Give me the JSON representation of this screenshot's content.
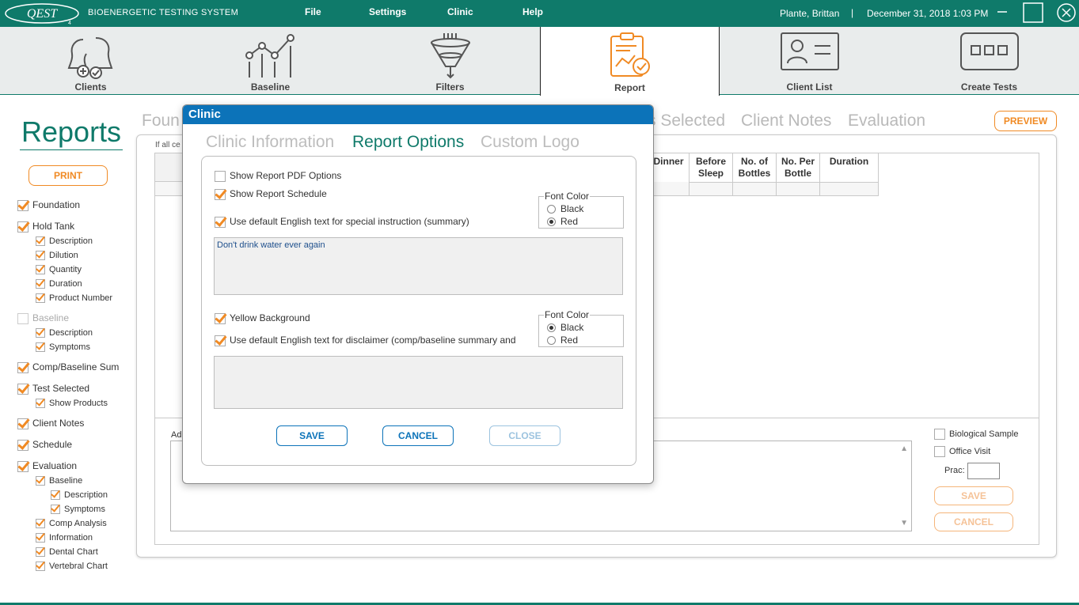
{
  "app": {
    "logo_text": "QEST",
    "logo_sub": "4",
    "title": "BIOENERGETIC TESTING SYSTEM",
    "user": "Plante, Brittan",
    "separator": "|",
    "datetime": "December 31, 2018  1:03 PM"
  },
  "menu": {
    "file": "File",
    "settings": "Settings",
    "clinic": "Clinic",
    "help": "Help"
  },
  "toolbar": [
    {
      "label": "Clients",
      "icon": "clients-icon"
    },
    {
      "label": "Baseline",
      "icon": "baseline-icon"
    },
    {
      "label": "Filters",
      "icon": "filters-icon"
    },
    {
      "label": "Report",
      "icon": "report-icon"
    },
    {
      "label": "Client List",
      "icon": "client-list-icon"
    },
    {
      "label": "Create Tests",
      "icon": "create-tests-icon"
    }
  ],
  "page": {
    "title": "Reports",
    "print": "PRINT",
    "preview": "PREVIEW",
    "bg_tabs": [
      "Foun",
      "s Selected",
      "Client Notes",
      "Evaluation"
    ],
    "hint": "If all ce",
    "notes_label": "Ad"
  },
  "sections": [
    {
      "label": "Foundation",
      "checked": true,
      "level": 0
    },
    {
      "label": "Hold Tank",
      "checked": true,
      "level": 0
    },
    {
      "label": "Description",
      "checked": true,
      "level": 1
    },
    {
      "label": "Dilution",
      "checked": true,
      "level": 1
    },
    {
      "label": "Quantity",
      "checked": true,
      "level": 1
    },
    {
      "label": "Duration",
      "checked": true,
      "level": 1
    },
    {
      "label": "Product Number",
      "checked": true,
      "level": 1
    },
    {
      "label": "Baseline",
      "checked": false,
      "level": 0,
      "disabled": true
    },
    {
      "label": "Description",
      "checked": true,
      "level": 1
    },
    {
      "label": "Symptoms",
      "checked": true,
      "level": 1
    },
    {
      "label": "Comp/Baseline Sum",
      "checked": true,
      "level": 0
    },
    {
      "label": "Test Selected",
      "checked": true,
      "level": 0
    },
    {
      "label": "Show Products",
      "checked": true,
      "level": 1
    },
    {
      "label": "Client Notes",
      "checked": true,
      "level": 0
    },
    {
      "label": "Schedule",
      "checked": true,
      "level": 0
    },
    {
      "label": "Evaluation",
      "checked": true,
      "level": 0
    },
    {
      "label": "Baseline",
      "checked": true,
      "level": 1
    },
    {
      "label": "Description",
      "checked": true,
      "level": 2
    },
    {
      "label": "Symptoms",
      "checked": true,
      "level": 2
    },
    {
      "label": "Comp Analysis",
      "checked": true,
      "level": 1
    },
    {
      "label": "Information",
      "checked": true,
      "level": 1
    },
    {
      "label": "Dental Chart",
      "checked": true,
      "level": 1
    },
    {
      "label": "Vertebral Chart",
      "checked": true,
      "level": 1
    }
  ],
  "table": {
    "headers": [
      "Dinner",
      "Before Sleep",
      "No. of Bottles",
      "No. Per Bottle",
      "Duration"
    ]
  },
  "right_panel": {
    "bio_sample": "Biological Sample",
    "office_visit": "Office Visit",
    "prac": "Prac:",
    "save": "SAVE",
    "cancel": "CANCEL"
  },
  "dialog": {
    "title": "Clinic",
    "tabs": [
      "Clinic Information",
      "Report Options",
      "Custom Logo"
    ],
    "active_tab": "Report Options",
    "show_pdf_options": {
      "label": "Show Report PDF Options",
      "checked": false
    },
    "show_schedule": {
      "label": "Show Report Schedule",
      "checked": true
    },
    "default_summary": {
      "label": "Use default English text for special instruction (summary)",
      "checked": true
    },
    "font_color_1": {
      "legend": "Font Color",
      "options": [
        "Black",
        "Red"
      ],
      "selected": "Red"
    },
    "summary_text": "Don't drink water ever again",
    "yellow_bg": {
      "label": "Yellow Background",
      "checked": true
    },
    "default_disclaimer": {
      "label": "Use default English text for disclaimer (comp/baseline summary and",
      "checked": true
    },
    "font_color_2": {
      "legend": "Font Color",
      "options": [
        "Black",
        "Red"
      ],
      "selected": "Black"
    },
    "disclaimer_text": "",
    "save": "SAVE",
    "cancel": "CANCEL",
    "close": "CLOSE"
  },
  "colors": {
    "brand": "#0f7a6a",
    "accent": "#f08a24",
    "dialog_header": "#0c73b9"
  }
}
